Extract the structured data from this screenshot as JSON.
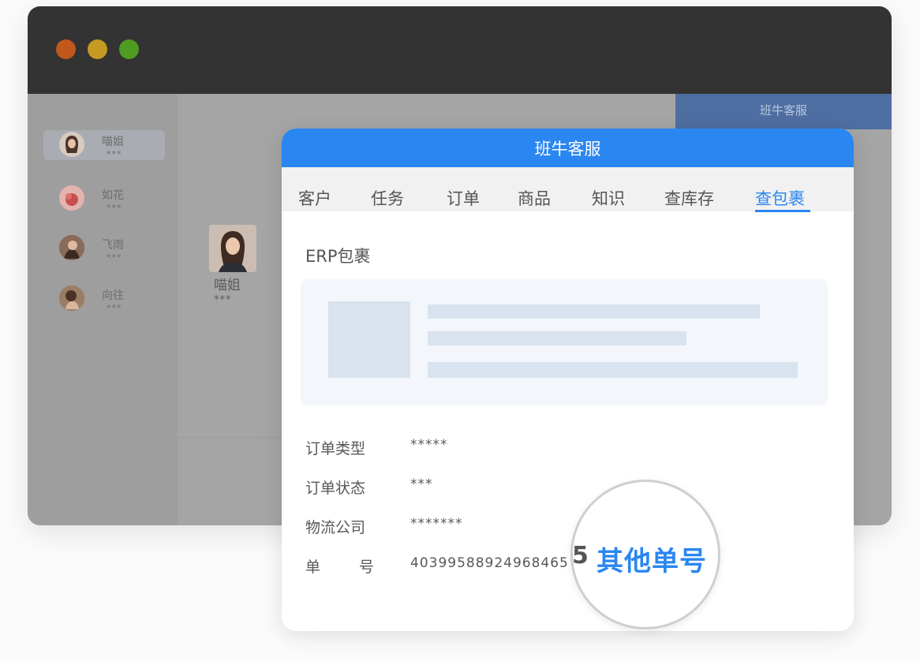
{
  "window_controls": {
    "close_color": "#c2581c",
    "minimize_color": "#c59a22",
    "maximize_color": "#4f9c22"
  },
  "sidebar": {
    "contacts": [
      {
        "name": "喵姐",
        "sub": "***",
        "active": true
      },
      {
        "name": "如花",
        "sub": "***",
        "active": false
      },
      {
        "name": "飞雨",
        "sub": "***",
        "active": false
      },
      {
        "name": "向往",
        "sub": "***",
        "active": false
      }
    ]
  },
  "chat": {
    "profile_name": "喵姐",
    "profile_sub": "***",
    "background_tab_label": "班牛客服"
  },
  "panel": {
    "title": "班牛客服",
    "accent_color": "#2a86f0",
    "tabs": [
      "客户",
      "任务",
      "订单",
      "商品",
      "知识",
      "查库存",
      "查包裹"
    ],
    "active_tab": "查包裹",
    "section_title": "ERP包裹",
    "fields": [
      {
        "label": "订单类型",
        "value": "*****"
      },
      {
        "label": "订单状态",
        "value": "***"
      },
      {
        "label": "物流公司",
        "value": "*******"
      },
      {
        "label": "单号",
        "label_chars": [
          "单",
          "号"
        ],
        "value": "40399588924968465"
      }
    ]
  },
  "magnifier": {
    "visible_digit": "5",
    "other_numbers_button": "其他单号"
  }
}
